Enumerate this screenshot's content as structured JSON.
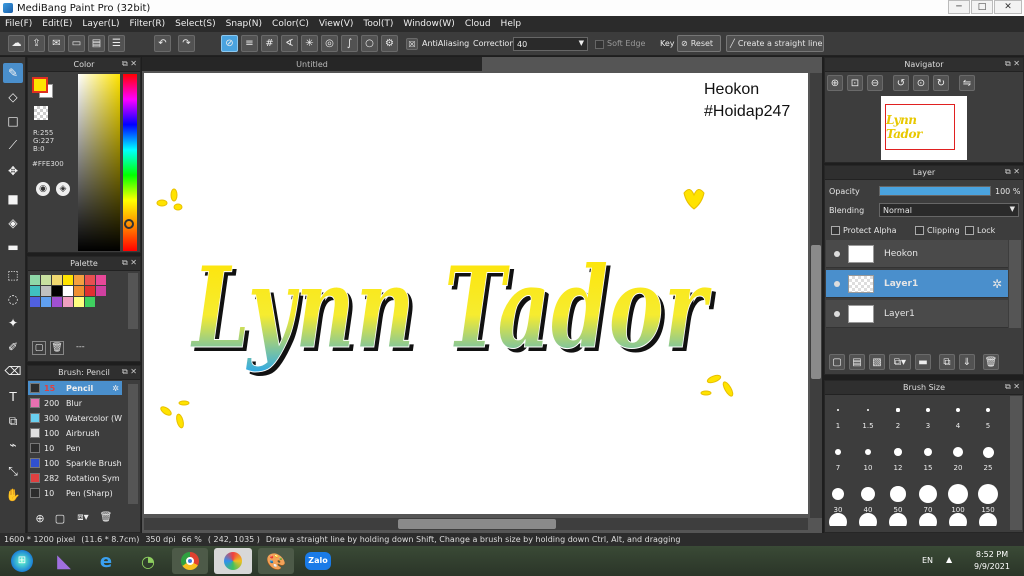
{
  "window": {
    "title": "MediBang Paint Pro (32bit)",
    "buttons": {
      "minimize": "─",
      "maximize": "□",
      "close": "✕"
    }
  },
  "menu": [
    "File(F)",
    "Edit(E)",
    "Layer(L)",
    "Filter(R)",
    "Select(S)",
    "Snap(N)",
    "Color(C)",
    "View(V)",
    "Tool(T)",
    "Window(W)",
    "Cloud",
    "Help"
  ],
  "toolbar": {
    "antialiasing": "AntiAliasing",
    "correction_label": "Correction",
    "correction_value": "40",
    "soft_edge": "Soft Edge",
    "key_label": "Key",
    "reset": "Reset",
    "straight_line": "Create a straight line"
  },
  "color_panel": {
    "title": "Color",
    "r": "R:255",
    "g": "G:227",
    "b": "B:0",
    "hex": "#FFE300",
    "fg": "#FFE300",
    "bg": "#ffffff"
  },
  "palette_panel": {
    "title": "Palette",
    "more": "---",
    "colors": [
      "#8fd8a8",
      "#c8e0a0",
      "#f0d870",
      "#ffe300",
      "#f4a040",
      "#e85050",
      "#e84898",
      "#40c0c0",
      "#c0c0c0",
      "#000000",
      "#ffffff",
      "#f09030",
      "#e03030",
      "#d040a0",
      "#5060e0",
      "#60a0f0",
      "#a050d0",
      "#f0a0c0",
      "#ffff80",
      "#40d060"
    ]
  },
  "brush_panel": {
    "title": "Brush: Pencil",
    "brushes": [
      {
        "size": "15",
        "name": "Pencil",
        "color": "#2d2d2d",
        "active": true
      },
      {
        "size": "200",
        "name": "Blur",
        "color": "#e870b0"
      },
      {
        "size": "300",
        "name": "Watercolor (W",
        "color": "#6ad0f0"
      },
      {
        "size": "100",
        "name": "Airbrush",
        "color": "#e0e0e0"
      },
      {
        "size": "10",
        "name": "Pen",
        "color": "#2d2d2d"
      },
      {
        "size": "100",
        "name": "Sparkle Brush",
        "color": "#3050d0"
      },
      {
        "size": "282",
        "name": "Rotation Sym",
        "color": "#e04040"
      },
      {
        "size": "10",
        "name": "Pen (Sharp)",
        "color": "#2d2d2d"
      }
    ]
  },
  "document": {
    "tab": "Untitled",
    "watermark_line1": "Heokon",
    "watermark_line2": "#Hoidap247",
    "art_text": "Lynn Tador"
  },
  "navigator": {
    "title": "Navigator",
    "preview_text": "Lynn Tador"
  },
  "layer_panel": {
    "title": "Layer",
    "opacity_label": "Opacity",
    "opacity_value": "100 %",
    "opacity": 1.0,
    "blending_label": "Blending",
    "blending_value": "Normal",
    "protect_alpha": "Protect Alpha",
    "clipping": "Clipping",
    "lock": "Lock",
    "layers": [
      {
        "name": "Heokon",
        "selected": false
      },
      {
        "name": "Layer1",
        "selected": true
      },
      {
        "name": "Layer1",
        "selected": false
      }
    ]
  },
  "brush_size_panel": {
    "title": "Brush Size",
    "sizes": [
      "1",
      "1.5",
      "2",
      "3",
      "4",
      "5",
      "7",
      "10",
      "12",
      "15",
      "20",
      "25",
      "30",
      "40",
      "50",
      "70",
      "100",
      "150"
    ]
  },
  "status": {
    "size": "1600 * 1200 pixel",
    "physical": "(11.6 * 8.7cm)",
    "dpi": "350 dpi",
    "zoom": "66 %",
    "coords": "( 242, 1035 )",
    "hint": "Draw a straight line by holding down Shift, Change a brush size by holding down Ctrl, Alt, and dragging"
  },
  "taskbar": {
    "lang": "EN",
    "time": "8:52 PM",
    "date": "9/9/2021",
    "zalo": "Zalo"
  }
}
